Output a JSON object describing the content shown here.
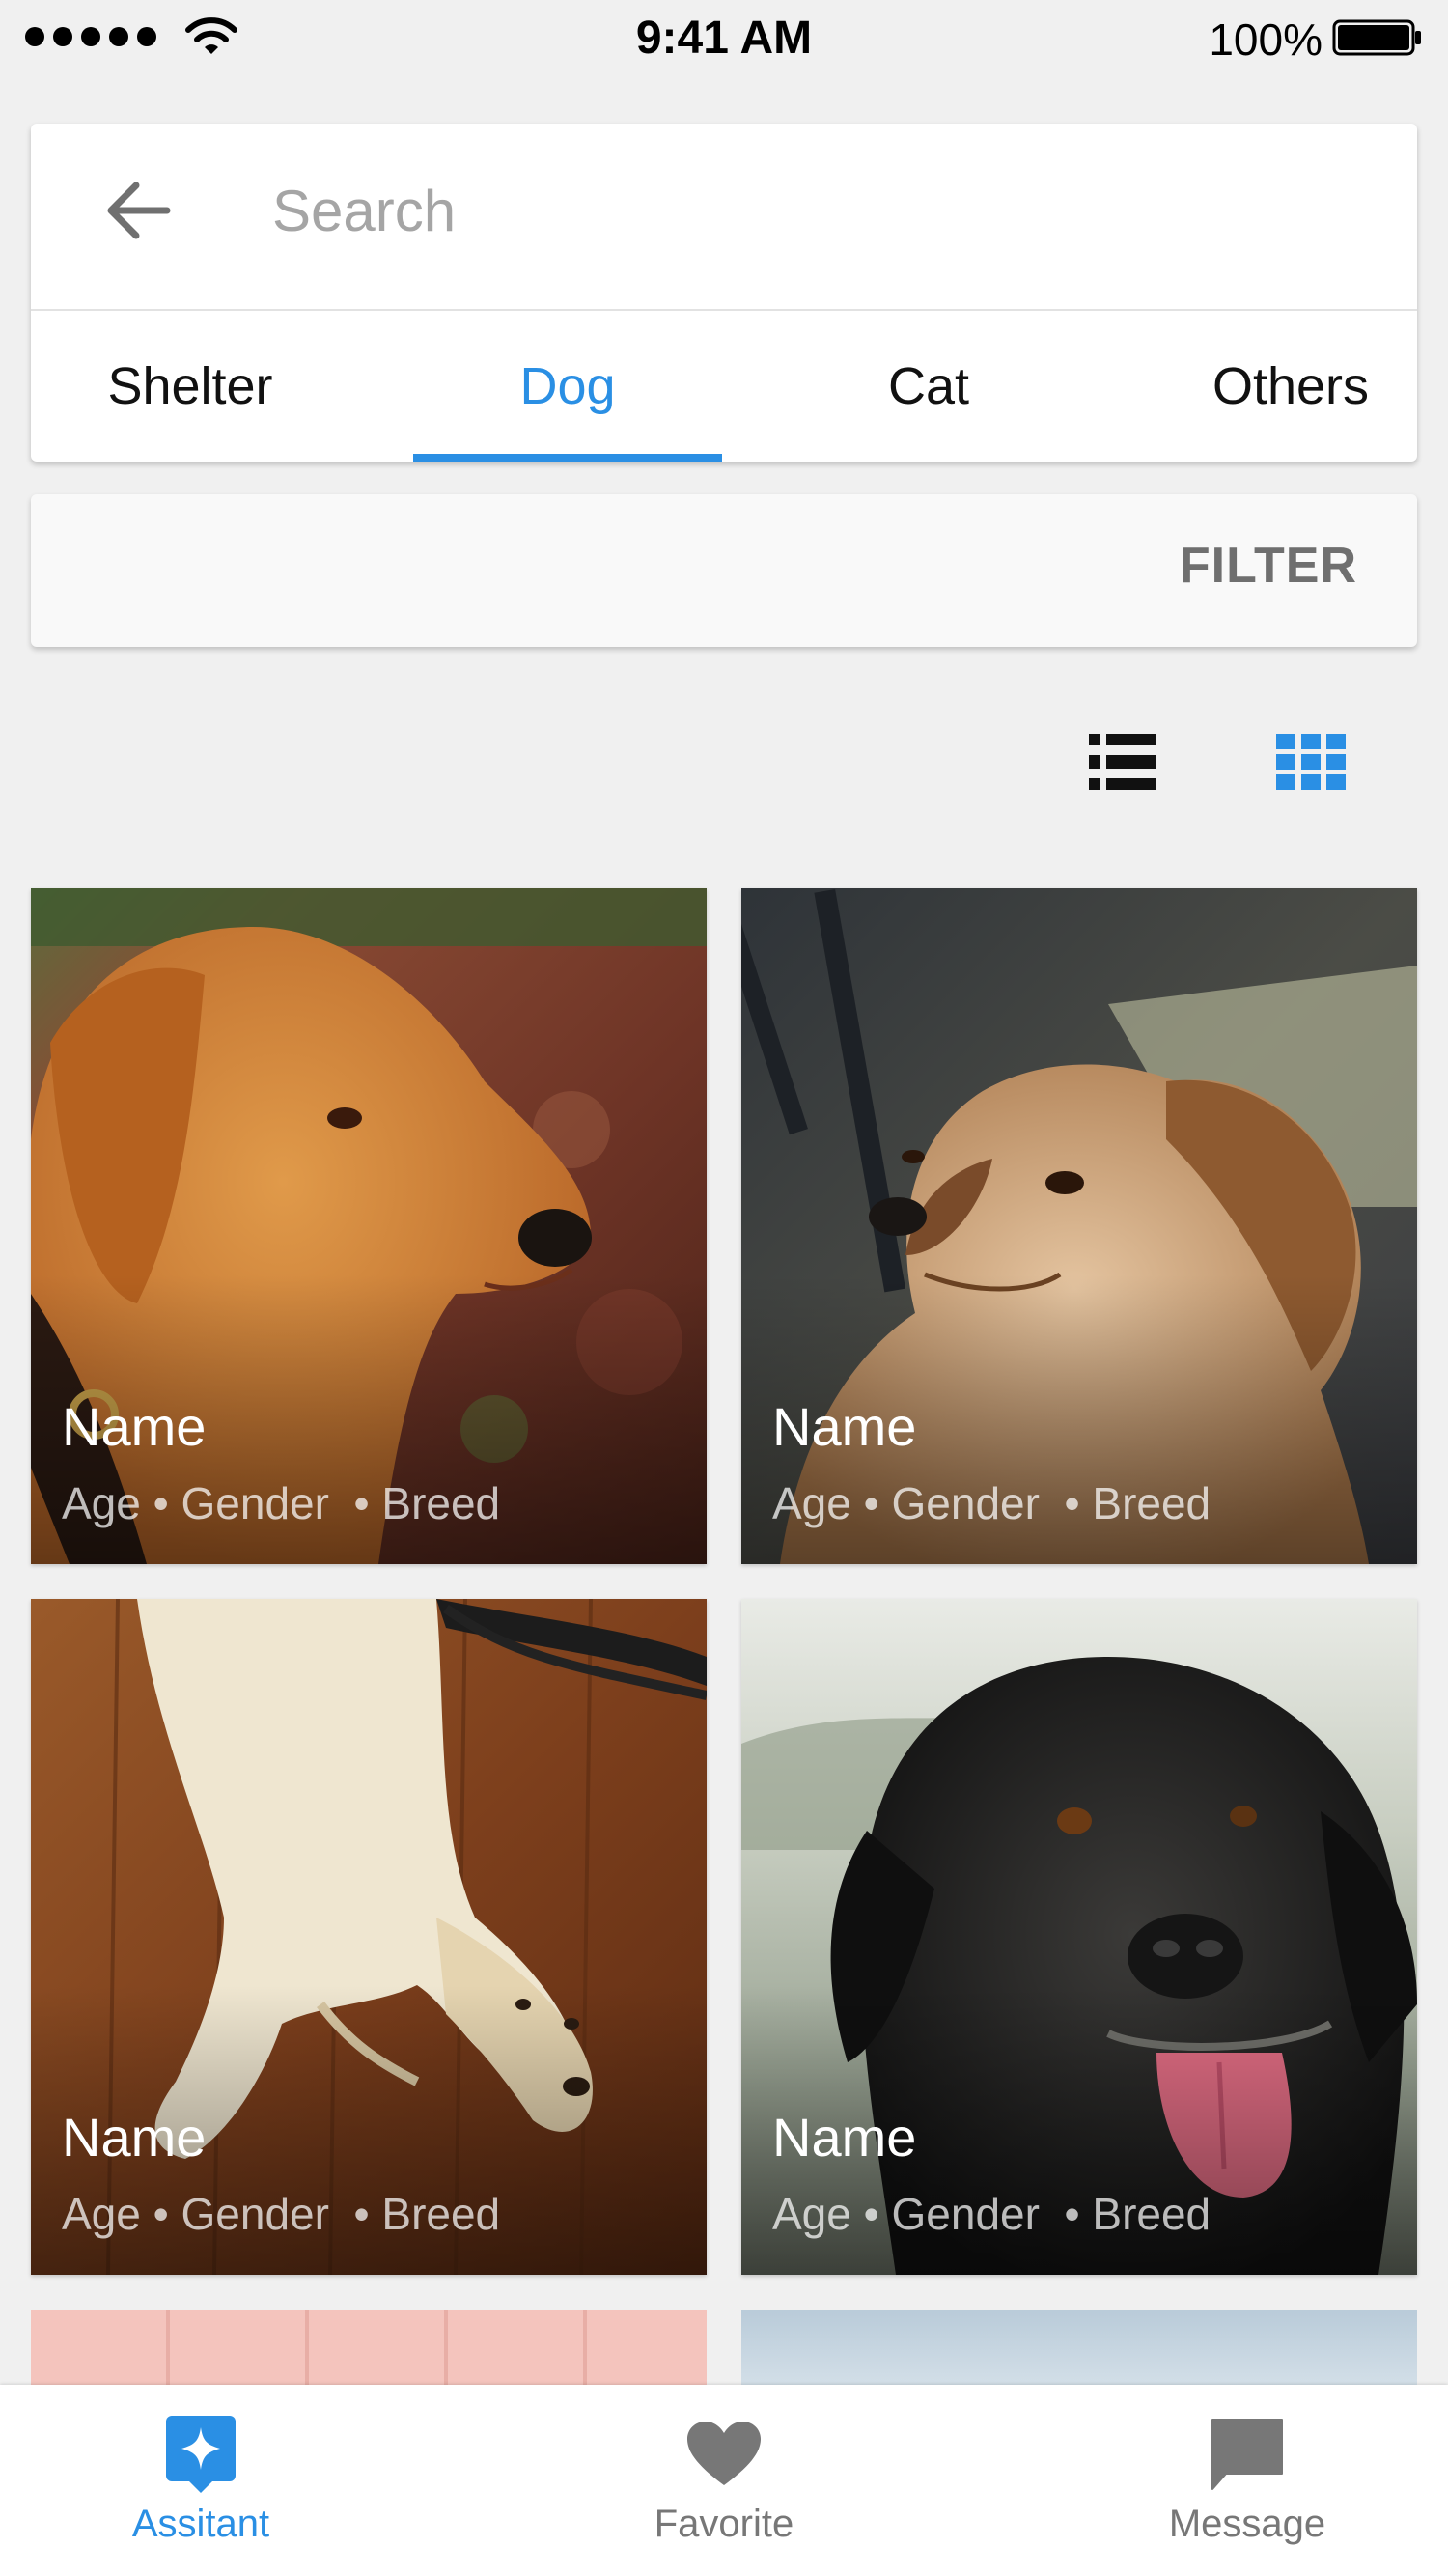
{
  "status_bar": {
    "time": "9:41 AM",
    "battery": "100%"
  },
  "search": {
    "placeholder": "Search"
  },
  "tabs": [
    {
      "label": "Shelter",
      "active": false
    },
    {
      "label": "Dog",
      "active": true
    },
    {
      "label": "Cat",
      "active": false
    },
    {
      "label": "Others",
      "active": false
    }
  ],
  "filter": {
    "label": "FILTER"
  },
  "view_toggle": {
    "list_icon": "list-view-icon",
    "grid_icon": "grid-view-icon",
    "selected": "grid"
  },
  "pets": [
    {
      "name": "Name",
      "meta": "Age • Gender  • Breed",
      "photo": "golden-retriever-leaves"
    },
    {
      "name": "Name",
      "meta": "Age • Gender  • Breed",
      "photo": "spaniel-looking-up"
    },
    {
      "name": "Name",
      "meta": "Age • Gender  • Breed",
      "photo": "puppy-wood-floor"
    },
    {
      "name": "Name",
      "meta": "Age • Gender  • Breed",
      "photo": "black-labrador"
    }
  ],
  "bottom_nav": [
    {
      "label": "Assitant",
      "icon": "assistant-icon",
      "active": true
    },
    {
      "label": "Favorite",
      "icon": "heart-icon",
      "active": false
    },
    {
      "label": "Message",
      "icon": "message-icon",
      "active": false
    }
  ],
  "colors": {
    "accent": "#2a8fe4",
    "background": "#f0f0f0",
    "inactive_icon": "#777777"
  }
}
